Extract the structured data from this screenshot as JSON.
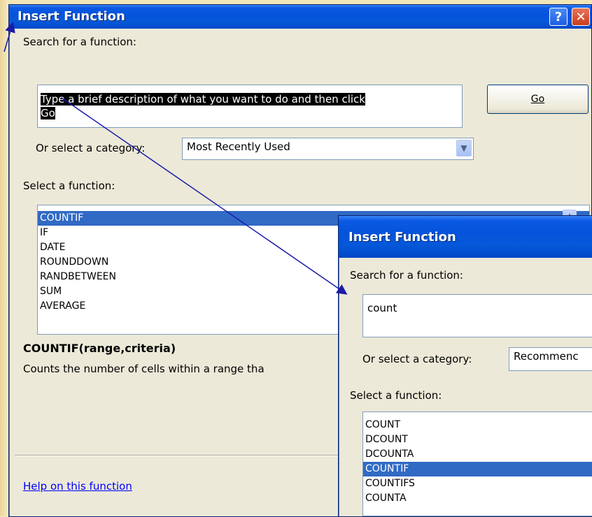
{
  "dialog1": {
    "title": "Insert Function",
    "help_label": "?",
    "close_label": "✕",
    "search_label": "Search for a function:",
    "search_value_line1": "Type a brief description of what you want to do and then click",
    "search_value_line2": "Go",
    "go_button": "Go",
    "category_label": "Or select a category:",
    "category_value": "Most Recently Used",
    "function_label": "Select a function:",
    "functions": [
      "COUNTIF",
      "IF",
      "DATE",
      "ROUNDDOWN",
      "RANDBETWEEN",
      "SUM",
      "AVERAGE"
    ],
    "selected_function": "COUNTIF",
    "signature": "COUNTIF(range,criteria)",
    "description": "Counts the number of cells within a range tha",
    "help_link": "Help on this function"
  },
  "dialog2": {
    "title": "Insert Function",
    "search_label": "Search for a function:",
    "search_value": "count",
    "category_label": "Or select a category:",
    "category_value": "Recommenc",
    "function_label": "Select a function:",
    "functions": [
      "COUNT",
      "DCOUNT",
      "DCOUNTA",
      "COUNTIF",
      "COUNTIFS",
      "COUNTA"
    ],
    "selected_function": "COUNTIF"
  },
  "colors": {
    "titlebar": "#0558d9",
    "selection": "#316ac5",
    "dialog_bg": "#ece9d8",
    "arrow": "#1a1aa8",
    "page_bg": "#f2e6b6"
  }
}
